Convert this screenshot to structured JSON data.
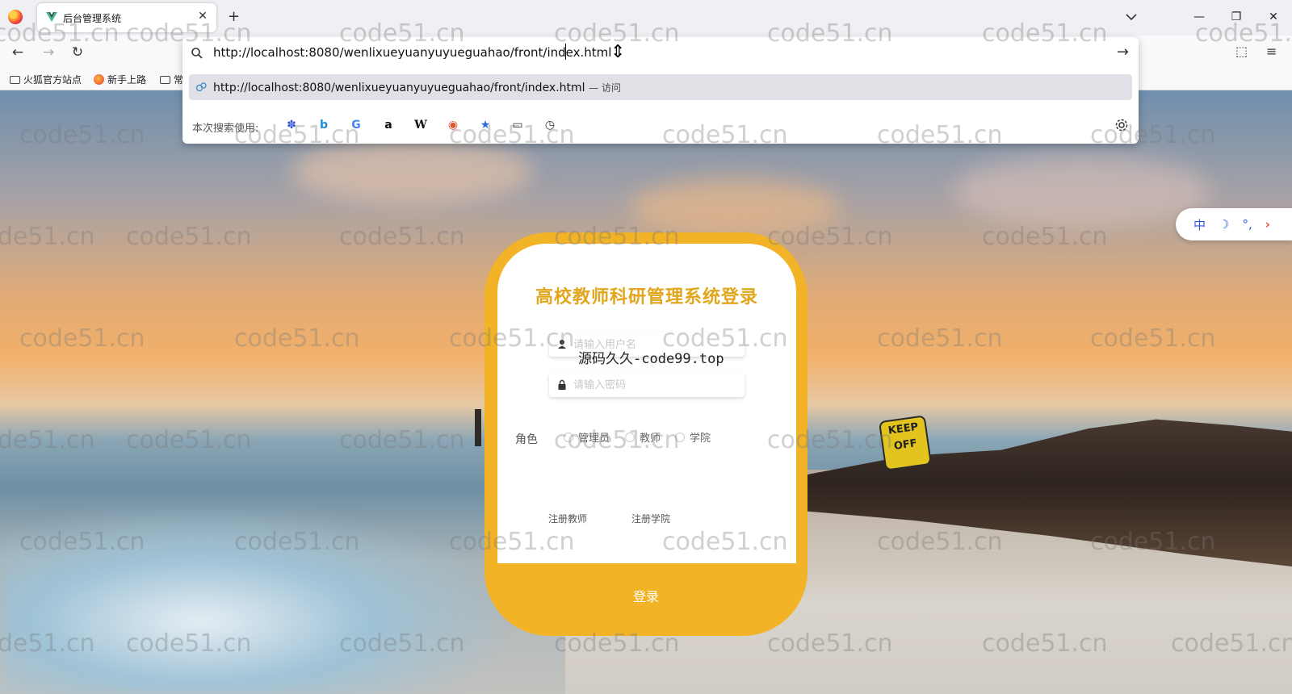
{
  "browser": {
    "tab_title": "后台管理系统",
    "new_tab": "+",
    "url": "http://localhost:8080/wenlixueyuanyuyueguahao/front/index.html",
    "suggestion_url": "http://localhost:8080/wenlixueyuanyuyueguahao/front/index.html",
    "suggestion_action": "— 访问",
    "engines_label": "本次搜索使用:",
    "engines": [
      "baidu-icon",
      "bing-icon",
      "google-icon",
      "amazon-icon",
      "wikipedia-icon",
      "duckduckgo-icon",
      "bookmarks-icon",
      "tabs-icon",
      "history-icon"
    ],
    "bookmarks": [
      "火狐官方站点",
      "新手上路",
      "常"
    ]
  },
  "watermark": "code51.cn",
  "overlay_text": "源码久久-code99.top",
  "login": {
    "title": "高校教师科研管理系统登录",
    "username_placeholder": "请输入用户名",
    "password_placeholder": "请输入密码",
    "role_label": "角色",
    "roles": [
      "管理员",
      "教师",
      "学院"
    ],
    "register_teacher": "注册教师",
    "register_college": "注册学院",
    "login_button": "登录"
  },
  "ime": {
    "lang": "中",
    "moon": "☽",
    "punct": "°,"
  },
  "colors": {
    "card": "#f3b326",
    "title": "#e2a61c"
  }
}
